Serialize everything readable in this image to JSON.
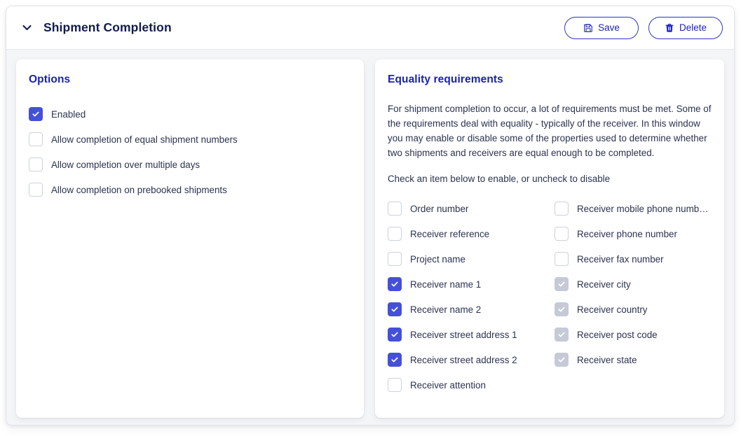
{
  "header": {
    "title": "Shipment Completion",
    "collapse_icon": "chevron-down-icon",
    "save_label": "Save",
    "save_icon": "floppy-disk-save-icon",
    "delete_label": "Delete",
    "delete_icon": "trash-can-icon"
  },
  "colors": {
    "accent_blue": "#4450d8",
    "heading_blue": "#1a21b6",
    "button_blue": "#1c25bb",
    "title_navy": "#131c4e",
    "text": "#2b3350",
    "checkbox_border": "#ccd1dd",
    "checkbox_disabled": "#c5cad6",
    "body_background": "#f4f5f7"
  },
  "options_card": {
    "title": "Options",
    "items": [
      {
        "label": "Enabled",
        "checked": true,
        "disabled": false
      },
      {
        "label": "Allow completion of equal shipment numbers",
        "checked": false,
        "disabled": false
      },
      {
        "label": "Allow completion over multiple days",
        "checked": false,
        "disabled": false
      },
      {
        "label": "Allow completion on prebooked shipments",
        "checked": false,
        "disabled": false
      }
    ]
  },
  "equality_card": {
    "title": "Equality requirements",
    "description": "For shipment completion to occur, a lot of requirements must be met. Some of the requirements deal with equality - typically of the receiver. In this window you may enable or disable some of the properties used to determine whether two shipments and receivers are equal enough to be completed.",
    "hint": "Check an item below to enable, or uncheck to disable",
    "left_column": [
      {
        "label": "Order number",
        "checked": false,
        "disabled": false
      },
      {
        "label": "Receiver reference",
        "checked": false,
        "disabled": false
      },
      {
        "label": "Project name",
        "checked": false,
        "disabled": false
      },
      {
        "label": "Receiver name 1",
        "checked": true,
        "disabled": false
      },
      {
        "label": "Receiver name 2",
        "checked": true,
        "disabled": false
      },
      {
        "label": "Receiver street address 1",
        "checked": true,
        "disabled": false
      },
      {
        "label": "Receiver street address 2",
        "checked": true,
        "disabled": false
      },
      {
        "label": "Receiver attention",
        "checked": false,
        "disabled": false
      }
    ],
    "right_column": [
      {
        "label": "Receiver mobile phone numb…",
        "checked": false,
        "disabled": false
      },
      {
        "label": "Receiver phone number",
        "checked": false,
        "disabled": false
      },
      {
        "label": "Receiver fax number",
        "checked": false,
        "disabled": false
      },
      {
        "label": "Receiver city",
        "checked": true,
        "disabled": true
      },
      {
        "label": "Receiver country",
        "checked": true,
        "disabled": true
      },
      {
        "label": "Receiver post code",
        "checked": true,
        "disabled": true
      },
      {
        "label": "Receiver state",
        "checked": true,
        "disabled": true
      }
    ]
  }
}
